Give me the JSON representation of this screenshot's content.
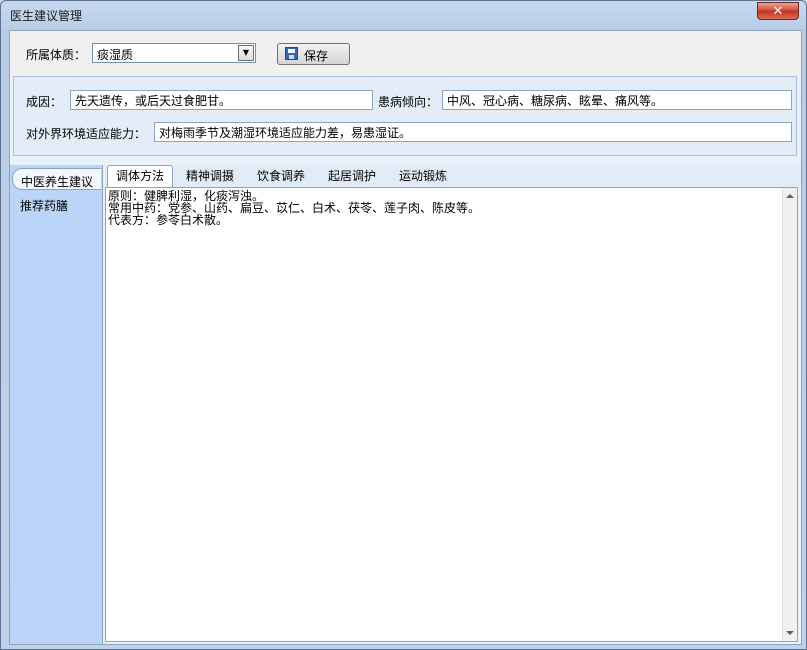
{
  "window": {
    "title": "医生建议管理",
    "close_label": "✕"
  },
  "toolbar": {
    "constitution_label": "所属体质：",
    "constitution_value": "痰湿质",
    "save_label": "保存"
  },
  "info": {
    "cause_label": "成因：",
    "cause_value": "先天遗传，或后天过食肥甘。",
    "tendency_label": "患病倾向：",
    "tendency_value": "中风、冠心病、糖尿病、眩晕、痛风等。",
    "adapt_label": "对外界环境适应能力：",
    "adapt_value": "对梅雨季节及潮湿环境适应能力差，易患湿证。"
  },
  "sidebar": {
    "items": [
      {
        "label": "中医养生建议"
      },
      {
        "label": "推荐药膳"
      }
    ]
  },
  "tabs": [
    {
      "label": "调体方法"
    },
    {
      "label": "精神调摄"
    },
    {
      "label": "饮食调养"
    },
    {
      "label": "起居调护"
    },
    {
      "label": "运动锻炼"
    }
  ],
  "content": {
    "lines": [
      "原则：健脾利湿，化痰泻浊。",
      "常用中药：党参、山药、扁豆、苡仁、白术、茯苓、莲子肉、陈皮等。",
      "代表方：参苓白术散。"
    ]
  }
}
